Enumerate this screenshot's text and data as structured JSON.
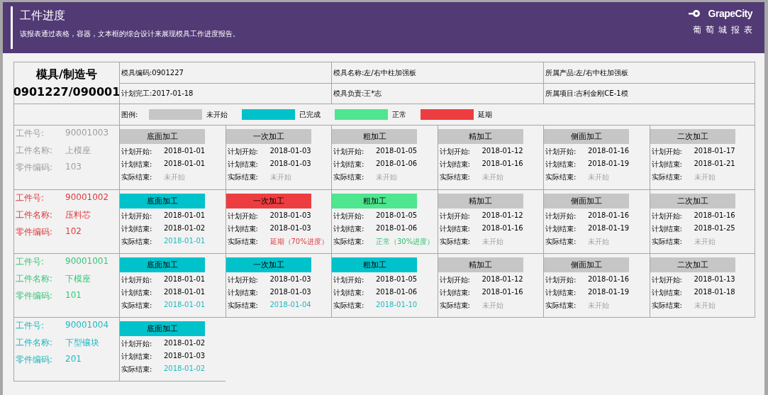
{
  "header": {
    "title": "工件进度",
    "subtitle": "该报表通过表格，容器，文本框的综合设计来展现模具工作进度报告。",
    "brand": "GrapeCity",
    "brand_tagline": "葡萄城报表"
  },
  "mold": {
    "heading": "模具/制造号",
    "number": "0901227/090001",
    "info": [
      {
        "text": "模具编码:0901227"
      },
      {
        "text": "模具名称:左/右中柱加强板"
      },
      {
        "text": "所属产品:左/右中柱加强板"
      },
      {
        "text": "计划完工:2017-01-18"
      },
      {
        "text": "模具负责:王*志"
      },
      {
        "text": "所属项目:吉利金刚CE-1模"
      }
    ]
  },
  "legend": {
    "label": "图例:",
    "items": [
      {
        "kind": "pending",
        "label": "未开始"
      },
      {
        "kind": "done",
        "label": "已完成"
      },
      {
        "kind": "normal",
        "label": "正常"
      },
      {
        "kind": "delayed",
        "label": "延期"
      }
    ]
  },
  "parts": [
    {
      "color": "#9e9e9e",
      "fields": [
        {
          "label": "工件号:",
          "value": "90001003"
        },
        {
          "label": "工件名称:",
          "value": "上模座"
        },
        {
          "label": "零件编码:",
          "value": "103"
        }
      ],
      "stages": [
        {
          "name": "底面加工",
          "kind": "pending",
          "rows": [
            {
              "label": "计划开始:",
              "value": "2018-01-01"
            },
            {
              "label": "计划结束:",
              "value": "2018-01-01"
            },
            {
              "label": "实际结束:",
              "value": "未开始"
            }
          ]
        },
        {
          "name": "一次加工",
          "kind": "pending",
          "rows": [
            {
              "label": "计划开始:",
              "value": "2018-01-03"
            },
            {
              "label": "计划结束:",
              "value": "2018-01-03"
            },
            {
              "label": "实际结束:",
              "value": "未开始"
            }
          ]
        },
        {
          "name": "粗加工",
          "kind": "pending",
          "rows": [
            {
              "label": "计划开始:",
              "value": "2018-01-05"
            },
            {
              "label": "计划结束:",
              "value": "2018-01-06"
            },
            {
              "label": "实际结束:",
              "value": "未开始"
            }
          ]
        },
        {
          "name": "精加工",
          "kind": "pending",
          "rows": [
            {
              "label": "计划开始:",
              "value": "2018-01-12"
            },
            {
              "label": "计划结束:",
              "value": "2018-01-16"
            },
            {
              "label": "实际结束:",
              "value": "未开始"
            }
          ]
        },
        {
          "name": "侧面加工",
          "kind": "pending",
          "rows": [
            {
              "label": "计划开始:",
              "value": "2018-01-16"
            },
            {
              "label": "计划结束:",
              "value": "2018-01-19"
            },
            {
              "label": "实际结束:",
              "value": "未开始"
            }
          ]
        },
        {
          "name": "二次加工",
          "kind": "pending",
          "rows": [
            {
              "label": "计划开始:",
              "value": "2018-01-17"
            },
            {
              "label": "计划结束:",
              "value": "2018-01-21"
            },
            {
              "label": "实际结束:",
              "value": "未开始"
            }
          ]
        }
      ]
    },
    {
      "color": "#e0393e",
      "fields": [
        {
          "label": "工件号:",
          "value": "90001002"
        },
        {
          "label": "工件名称:",
          "value": "压料芯"
        },
        {
          "label": "零件编码:",
          "value": "102"
        }
      ],
      "stages": [
        {
          "name": "底面加工",
          "kind": "done",
          "rows": [
            {
              "label": "计划开始:",
              "value": "2018-01-01"
            },
            {
              "label": "计划结束:",
              "value": "2018-01-02"
            },
            {
              "label": "实际结束:",
              "value": "2018-01-01"
            }
          ]
        },
        {
          "name": "一次加工",
          "kind": "delayed",
          "rows": [
            {
              "label": "计划开始:",
              "value": "2018-01-03"
            },
            {
              "label": "计划结束:",
              "value": "2018-01-03"
            },
            {
              "label": "实际结束:",
              "value": "延期（70%进度）"
            }
          ]
        },
        {
          "name": "粗加工",
          "kind": "normal",
          "rows": [
            {
              "label": "计划开始:",
              "value": "2018-01-05"
            },
            {
              "label": "计划结束:",
              "value": "2018-01-06"
            },
            {
              "label": "实际结束:",
              "value": "正常（30%进度）"
            }
          ]
        },
        {
          "name": "精加工",
          "kind": "pending",
          "rows": [
            {
              "label": "计划开始:",
              "value": "2018-01-12"
            },
            {
              "label": "计划结束:",
              "value": "2018-01-16"
            },
            {
              "label": "实际结束:",
              "value": "未开始"
            }
          ]
        },
        {
          "name": "侧面加工",
          "kind": "pending",
          "rows": [
            {
              "label": "计划开始:",
              "value": "2018-01-16"
            },
            {
              "label": "计划结束:",
              "value": "2018-01-19"
            },
            {
              "label": "实际结束:",
              "value": "未开始"
            }
          ]
        },
        {
          "name": "二次加工",
          "kind": "pending",
          "rows": [
            {
              "label": "计划开始:",
              "value": "2018-01-16"
            },
            {
              "label": "计划结束:",
              "value": "2018-01-25"
            },
            {
              "label": "实际结束:",
              "value": "未开始"
            }
          ]
        }
      ]
    },
    {
      "color": "#36c777",
      "fields": [
        {
          "label": "工件号:",
          "value": "90001001"
        },
        {
          "label": "工件名称:",
          "value": "下模座"
        },
        {
          "label": "零件编码:",
          "value": "101"
        }
      ],
      "stages": [
        {
          "name": "底面加工",
          "kind": "done",
          "rows": [
            {
              "label": "计划开始:",
              "value": "2018-01-01"
            },
            {
              "label": "计划结束:",
              "value": "2018-01-01"
            },
            {
              "label": "实际结束:",
              "value": "2018-01-01"
            }
          ]
        },
        {
          "name": "一次加工",
          "kind": "done",
          "rows": [
            {
              "label": "计划开始:",
              "value": "2018-01-03"
            },
            {
              "label": "计划结束:",
              "value": "2018-01-03"
            },
            {
              "label": "实际结束:",
              "value": "2018-01-04"
            }
          ]
        },
        {
          "name": "粗加工",
          "kind": "done",
          "rows": [
            {
              "label": "计划开始:",
              "value": "2018-01-05"
            },
            {
              "label": "计划结束:",
              "value": "2018-01-06"
            },
            {
              "label": "实际结束:",
              "value": "2018-01-10"
            }
          ]
        },
        {
          "name": "精加工",
          "kind": "pending",
          "rows": [
            {
              "label": "计划开始:",
              "value": "2018-01-12"
            },
            {
              "label": "计划结束:",
              "value": "2018-01-16"
            },
            {
              "label": "实际结束:",
              "value": "未开始"
            }
          ]
        },
        {
          "name": "侧面加工",
          "kind": "pending",
          "rows": [
            {
              "label": "计划开始:",
              "value": "2018-01-16"
            },
            {
              "label": "计划结束:",
              "value": "2018-01-19"
            },
            {
              "label": "实际结束:",
              "value": "未开始"
            }
          ]
        },
        {
          "name": "二次加工",
          "kind": "pending",
          "rows": [
            {
              "label": "计划开始:",
              "value": "2018-01-13"
            },
            {
              "label": "计划结束:",
              "value": "2018-01-18"
            },
            {
              "label": "实际结束:",
              "value": "未开始"
            }
          ]
        }
      ]
    },
    {
      "color": "#1fb8c1",
      "fields": [
        {
          "label": "工件号:",
          "value": "90001004"
        },
        {
          "label": "工件名称:",
          "value": "下型镶块"
        },
        {
          "label": "零件编码:",
          "value": "201"
        }
      ],
      "stages": [
        {
          "name": "底面加工",
          "kind": "done",
          "rows": [
            {
              "label": "计划开始:",
              "value": "2018-01-02"
            },
            {
              "label": "计划结束:",
              "value": "2018-01-03"
            },
            {
              "label": "实际结束:",
              "value": "2018-01-02"
            }
          ]
        }
      ]
    }
  ]
}
